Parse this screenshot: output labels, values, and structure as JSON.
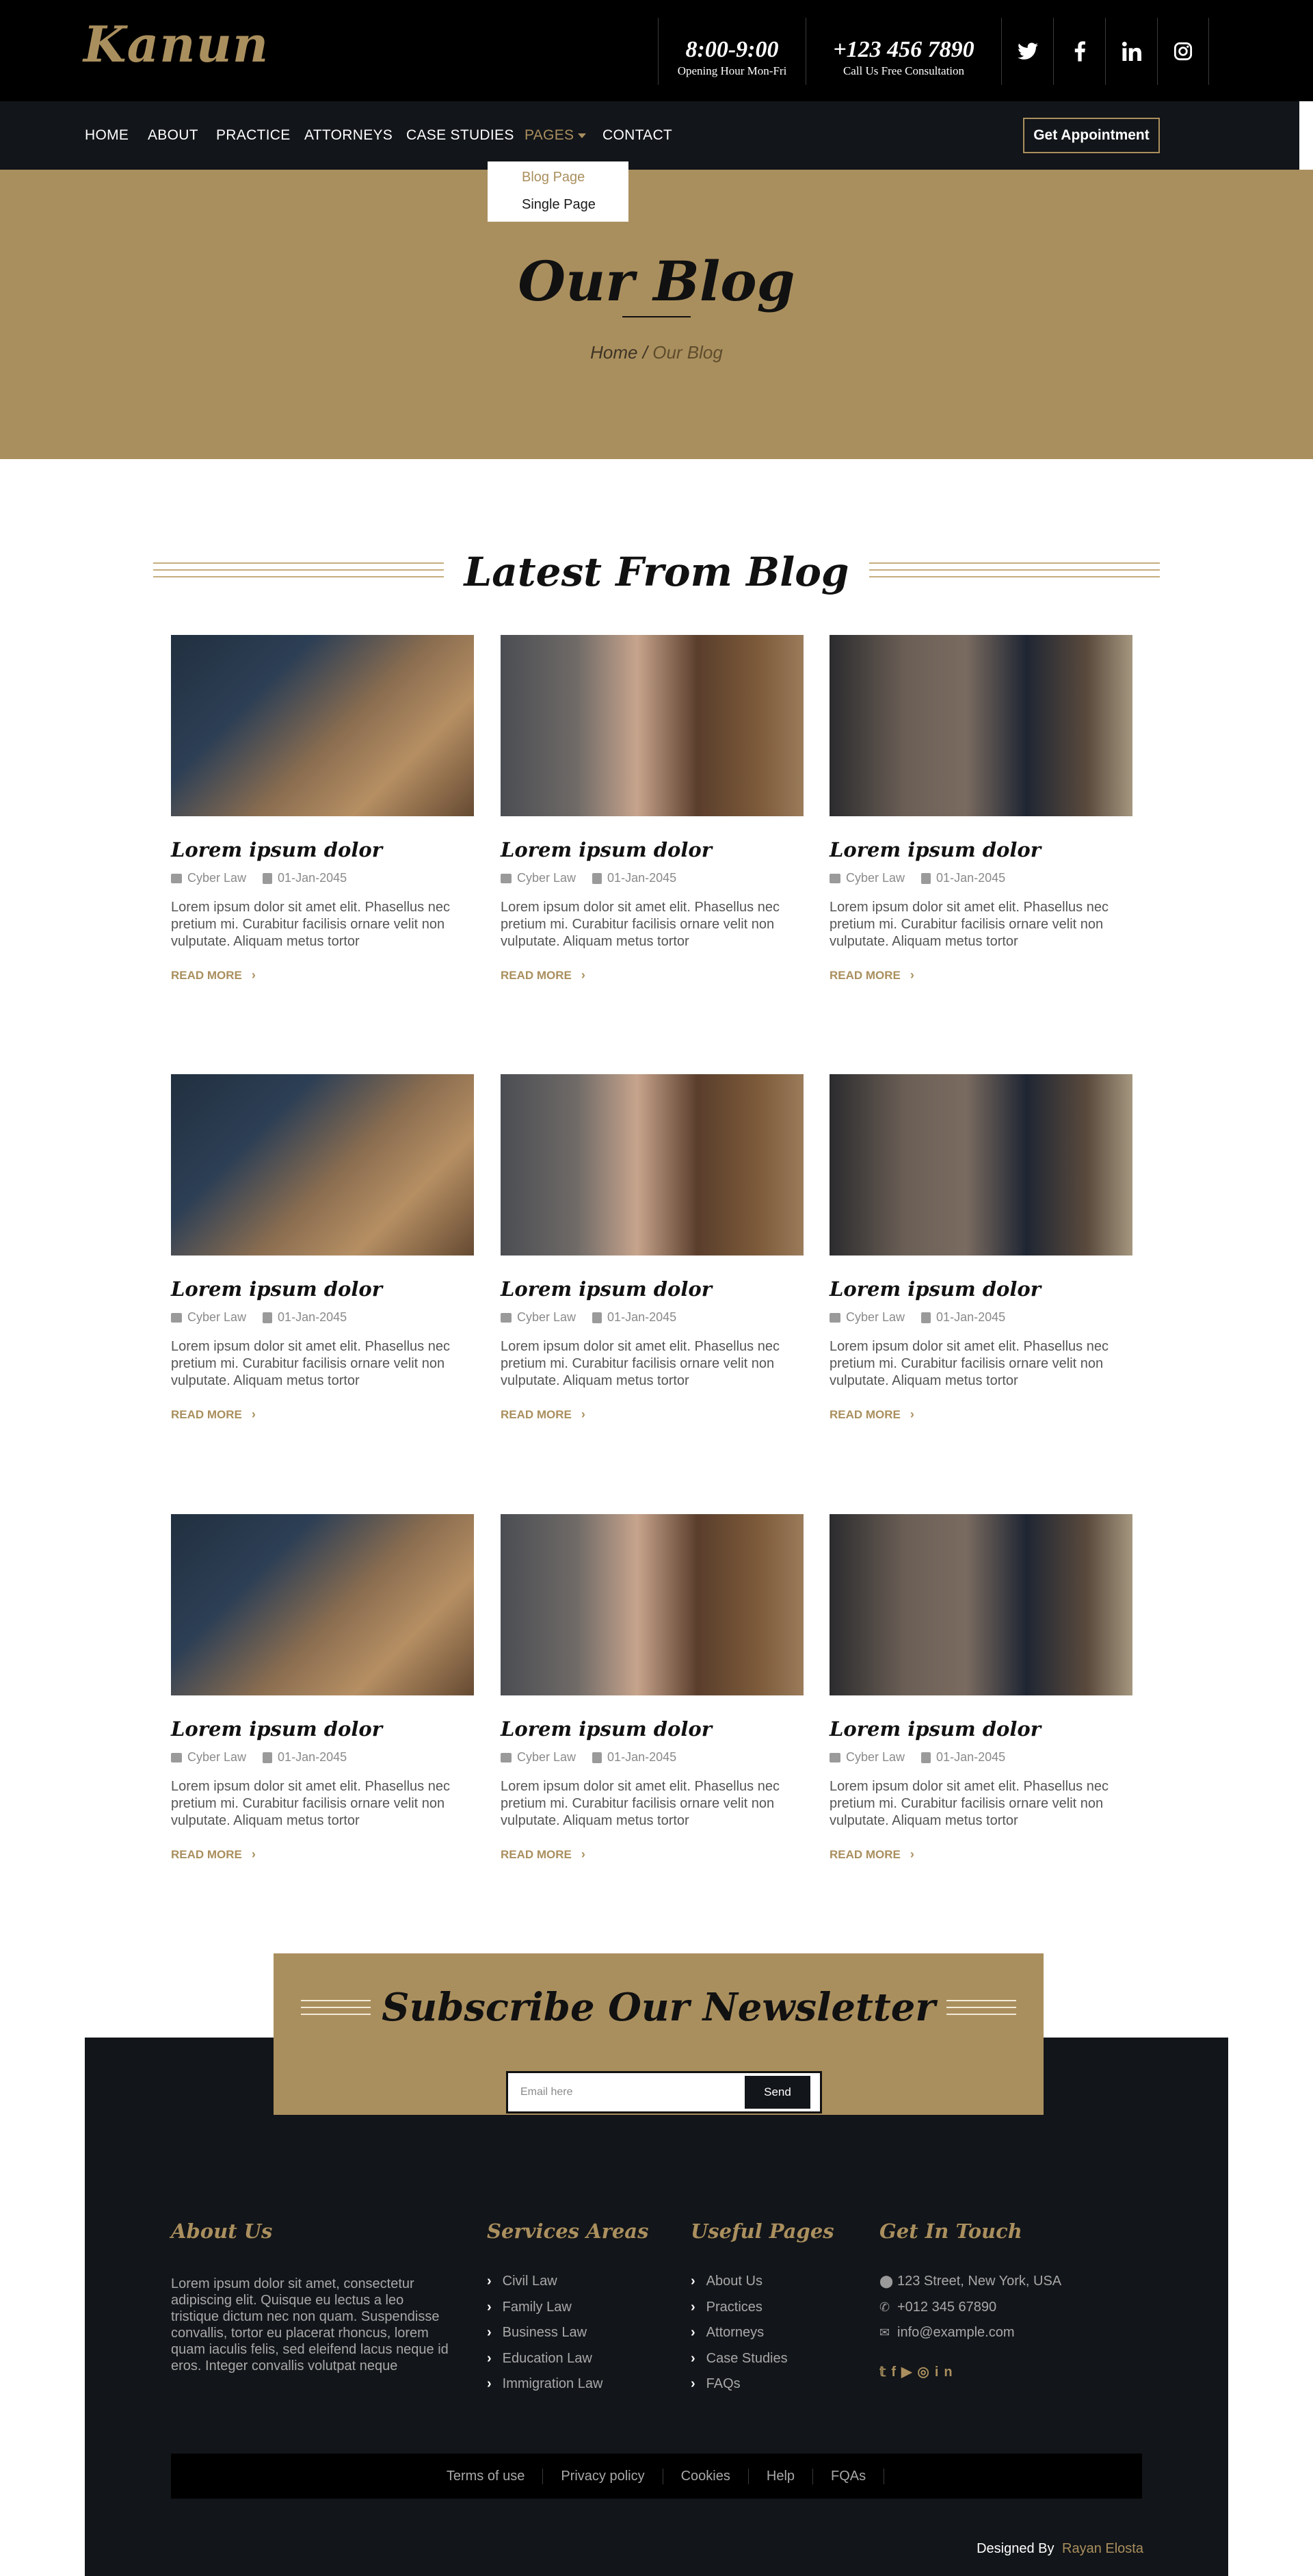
{
  "brand": {
    "logo": "Kanun",
    "accent": "#aa8f5e",
    "dark": "#121519"
  },
  "topbar": {
    "hours": {
      "value": "8:00-9:00",
      "label": "Opening Hour Mon-Fri"
    },
    "phone": {
      "value": "+123 456 7890",
      "label": "Call Us Free Consultation"
    },
    "social": [
      "twitter-icon",
      "facebook-icon",
      "linkedin-icon",
      "instagram-icon"
    ]
  },
  "nav": {
    "items": [
      "HOME",
      "ABOUT",
      "PRACTICE",
      "ATTORNEYS",
      "CASE STUDIES",
      "PAGES",
      "CONTACT"
    ],
    "active": "PAGES",
    "cta": "Get Appointment",
    "dropdown": [
      "Blog Page",
      "Single Page"
    ]
  },
  "banner": {
    "title": "Our Blog",
    "crumb_home": "Home",
    "crumb_sep": "/",
    "crumb_current": "Our Blog"
  },
  "blog": {
    "section_title": "Latest From Blog",
    "cards": [
      {
        "title": "Lorem ipsum dolor",
        "category": "Cyber Law",
        "date": "01-Jan-2045",
        "excerpt": "Lorem ipsum dolor sit amet elit. Phasellus nec pretium mi. Curabitur facilisis ornare velit non vulputate. Aliquam metus tortor",
        "read_more": "READ MORE"
      },
      {
        "title": "Lorem ipsum dolor",
        "category": "Cyber Law",
        "date": "01-Jan-2045",
        "excerpt": "Lorem ipsum dolor sit amet elit. Phasellus nec pretium mi. Curabitur facilisis ornare velit non vulputate. Aliquam metus tortor",
        "read_more": "READ MORE"
      },
      {
        "title": "Lorem ipsum dolor",
        "category": "Cyber Law",
        "date": "01-Jan-2045",
        "excerpt": "Lorem ipsum dolor sit amet elit. Phasellus nec pretium mi. Curabitur facilisis ornare velit non vulputate. Aliquam metus tortor",
        "read_more": "READ MORE"
      },
      {
        "title": "Lorem ipsum dolor",
        "category": "Cyber Law",
        "date": "01-Jan-2045",
        "excerpt": "Lorem ipsum dolor sit amet elit. Phasellus nec pretium mi. Curabitur facilisis ornare velit non vulputate. Aliquam metus tortor",
        "read_more": "READ MORE"
      },
      {
        "title": "Lorem ipsum dolor",
        "category": "Cyber Law",
        "date": "01-Jan-2045",
        "excerpt": "Lorem ipsum dolor sit amet elit. Phasellus nec pretium mi. Curabitur facilisis ornare velit non vulputate. Aliquam metus tortor",
        "read_more": "READ MORE"
      },
      {
        "title": "Lorem ipsum dolor",
        "category": "Cyber Law",
        "date": "01-Jan-2045",
        "excerpt": "Lorem ipsum dolor sit amet elit. Phasellus nec pretium mi. Curabitur facilisis ornare velit non vulputate. Aliquam metus tortor",
        "read_more": "READ MORE"
      },
      {
        "title": "Lorem ipsum dolor",
        "category": "Cyber Law",
        "date": "01-Jan-2045",
        "excerpt": "Lorem ipsum dolor sit amet elit. Phasellus nec pretium mi. Curabitur facilisis ornare velit non vulputate. Aliquam metus tortor",
        "read_more": "READ MORE"
      },
      {
        "title": "Lorem ipsum dolor",
        "category": "Cyber Law",
        "date": "01-Jan-2045",
        "excerpt": "Lorem ipsum dolor sit amet elit. Phasellus nec pretium mi. Curabitur facilisis ornare velit non vulputate. Aliquam metus tortor",
        "read_more": "READ MORE"
      },
      {
        "title": "Lorem ipsum dolor",
        "category": "Cyber Law",
        "date": "01-Jan-2045",
        "excerpt": "Lorem ipsum dolor sit amet elit. Phasellus nec pretium mi. Curabitur facilisis ornare velit non vulputate. Aliquam metus tortor",
        "read_more": "READ MORE"
      }
    ]
  },
  "newsletter": {
    "title": "Subscribe Our Newsletter",
    "placeholder": "Email here",
    "button": "Send"
  },
  "footer": {
    "about": {
      "title": "About Us",
      "text": "Lorem ipsum dolor sit amet, consectetur adipiscing elit. Quisque eu lectus a leo tristique dictum nec non quam. Suspendisse convallis, tortor eu placerat rhoncus, lorem quam iaculis felis, sed eleifend lacus neque id eros. Integer convallis volutpat neque"
    },
    "services": {
      "title": "Services Areas",
      "items": [
        "Civil Law",
        "Family Law",
        "Business Law",
        "Education Law",
        "Immigration Law"
      ]
    },
    "pages": {
      "title": "Useful Pages",
      "items": [
        "About Us",
        "Practices",
        "Attorneys",
        "Case Studies",
        "FAQs"
      ]
    },
    "contact": {
      "title": "Get In Touch",
      "address": "123 Street, New York, USA",
      "phone": "+012 345 67890",
      "email": "info@example.com"
    },
    "social": [
      "twitter-icon",
      "facebook-icon",
      "youtube-icon",
      "instagram-icon",
      "linkedin-icon"
    ],
    "bottom_links": [
      "Terms of use",
      "Privacy policy",
      "Cookies",
      "Help",
      "FQAs"
    ],
    "credit": {
      "label": "Designed By",
      "name": "Rayan Elosta"
    }
  }
}
